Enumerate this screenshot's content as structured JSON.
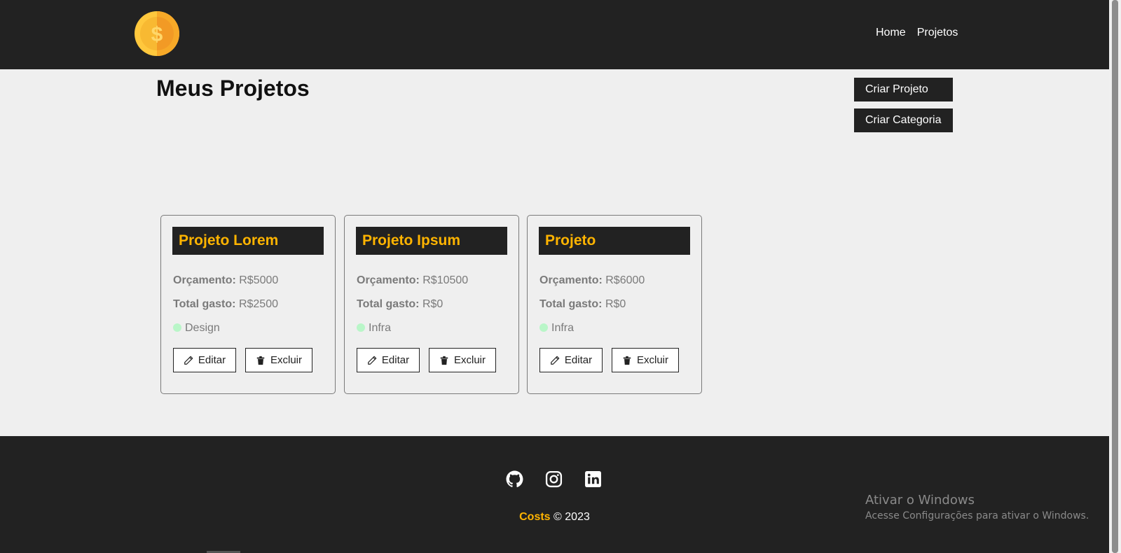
{
  "nav": {
    "links": [
      "Home",
      "Projetos"
    ]
  },
  "main": {
    "title": "Meus Projetos",
    "create_project_label": "Criar Projeto",
    "create_category_label": "Criar Categoria"
  },
  "projects": [
    {
      "name": "Projeto Lorem",
      "budget_label": "Orçamento:",
      "budget": "R$5000",
      "spent_label": "Total gasto:",
      "spent": "R$2500",
      "category": "Design",
      "edit_label": "Editar",
      "delete_label": "Excluir"
    },
    {
      "name": "Projeto Ipsum",
      "budget_label": "Orçamento:",
      "budget": "R$10500",
      "spent_label": "Total gasto:",
      "spent": "R$0",
      "category": "Infra",
      "edit_label": "Editar",
      "delete_label": "Excluir"
    },
    {
      "name": "Projeto",
      "budget_label": "Orçamento:",
      "budget": "R$6000",
      "spent_label": "Total gasto:",
      "spent": "R$0",
      "category": "Infra",
      "edit_label": "Editar",
      "delete_label": "Excluir"
    }
  ],
  "footer": {
    "brand": "Costs",
    "copyright": "© 2023",
    "social_icons": [
      "github-icon",
      "instagram-icon",
      "linkedin-icon"
    ]
  },
  "windows_watermark": {
    "title": "Ativar o Windows",
    "subtitle": "Acesse Configurações para ativar o Windows."
  },
  "colors": {
    "dark": "#222222",
    "accent": "#ffb400",
    "background": "#efefef",
    "category_dot": "#b9f6c8"
  }
}
